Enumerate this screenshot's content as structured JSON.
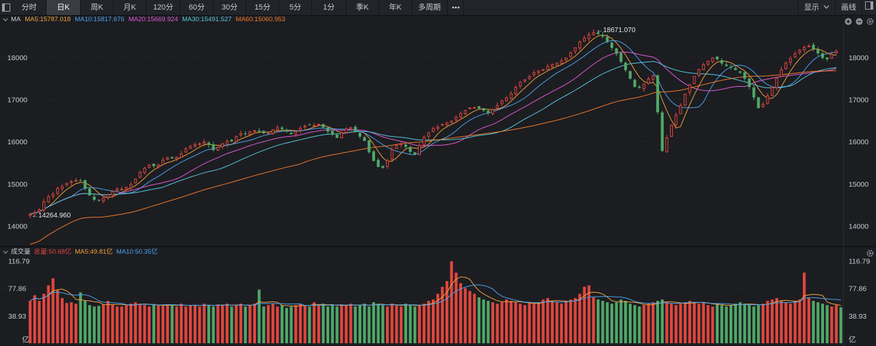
{
  "toolbar": {
    "tabs": [
      "分时",
      "日K",
      "周K",
      "月K",
      "120分",
      "60分",
      "30分",
      "15分",
      "5分",
      "1分",
      "季K",
      "年K",
      "多周期"
    ],
    "active_index": 1,
    "more_icon": "more-dots-icon",
    "display_label": "显示",
    "draw_label": "画线"
  },
  "price_panel": {
    "indicator": "MA",
    "ma_items": [
      {
        "label": "MA5:15787.018",
        "color": "#f0a33a"
      },
      {
        "label": "MA10:15817.676",
        "color": "#4aa3f0"
      },
      {
        "label": "MA20:15669.924",
        "color": "#e05ad6"
      },
      {
        "label": "MA30:15491.527",
        "color": "#56c8de"
      },
      {
        "label": "MA60:15060.953",
        "color": "#f07a2a"
      }
    ],
    "y_ticks": [
      "18000",
      "17000",
      "16000",
      "15000",
      "14000"
    ],
    "high_label": "18671.070",
    "low_label": "14264.960"
  },
  "volume_panel": {
    "title": "成交量",
    "total_label": "总量:50.68亿",
    "ma5_label": "MA5:49.81亿",
    "ma10_label": "MA10:50.35亿",
    "y_ticks": [
      "116.79",
      "77.86",
      "38.93"
    ],
    "unit": "亿"
  },
  "colors": {
    "up": "#e0463e",
    "down": "#4fa868",
    "ma5": "#f0a33a",
    "ma10": "#4aa3f0",
    "ma20": "#e05ad6",
    "ma30": "#56c8de",
    "ma60": "#f07a2a"
  },
  "chart_data": [
    {
      "type": "candlestick",
      "ylim": [
        13550,
        18750
      ],
      "annotations": {
        "high": 18671.07,
        "low": 14264.96
      },
      "series": [
        {
          "name": "MA5",
          "value_last": 15787.018
        },
        {
          "name": "MA10",
          "value_last": 15817.676
        },
        {
          "name": "MA20",
          "value_last": 15669.924
        },
        {
          "name": "MA30",
          "value_last": 15491.527
        },
        {
          "name": "MA60",
          "value_last": 15060.953
        }
      ],
      "close": [
        14280,
        14330,
        14390,
        14580,
        14700,
        14760,
        14900,
        14940,
        15020,
        15060,
        15090,
        15070,
        14880,
        14720,
        14620,
        14600,
        14660,
        14750,
        14830,
        14880,
        14880,
        14920,
        14990,
        15120,
        15280,
        15380,
        15450,
        15420,
        15450,
        15570,
        15620,
        15600,
        15640,
        15720,
        15840,
        15900,
        15940,
        15960,
        16000,
        15920,
        15800,
        15880,
        15960,
        16020,
        16010,
        16130,
        16200,
        16180,
        16240,
        16270,
        16240,
        16200,
        16210,
        16290,
        16340,
        16300,
        16240,
        16180,
        16250,
        16330,
        16380,
        16400,
        16390,
        16420,
        16340,
        16240,
        16170,
        16090,
        16220,
        16310,
        16340,
        16230,
        16120,
        16020,
        15750,
        15540,
        15400,
        15380,
        15560,
        15820,
        15920,
        15960,
        15880,
        15760,
        15700,
        15920,
        16110,
        16220,
        16320,
        16360,
        16420,
        16460,
        16500,
        16590,
        16680,
        16750,
        16810,
        16820,
        16790,
        16740,
        16680,
        16770,
        16870,
        16980,
        17050,
        17150,
        17300,
        17420,
        17480,
        17560,
        17650,
        17690,
        17720,
        17800,
        17840,
        17880,
        17930,
        18000,
        18120,
        18240,
        18380,
        18470,
        18550,
        18600,
        18560,
        18500,
        18370,
        18230,
        18090,
        17900,
        17700,
        17500,
        17300,
        17280,
        17380,
        17500,
        17580,
        16700,
        15780,
        16100,
        16400,
        16640,
        16870,
        17140,
        17360,
        17560,
        17720,
        17840,
        17920,
        18000,
        17960,
        17860,
        17800,
        17760,
        17700,
        17640,
        17500,
        17300,
        17050,
        16800,
        16900,
        17100,
        17300,
        17520,
        17720,
        17880,
        17980,
        18100,
        18180,
        18250,
        18280,
        18200,
        18100,
        17990,
        17960,
        18080,
        18160
      ],
      "volume": [
        60,
        68,
        60,
        70,
        82,
        92,
        75,
        64,
        57,
        58,
        56,
        72,
        60,
        54,
        52,
        53,
        55,
        60,
        55,
        52,
        52,
        54,
        56,
        58,
        56,
        54,
        52,
        55,
        54,
        53,
        55,
        54,
        52,
        56,
        52,
        54,
        54,
        52,
        56,
        54,
        52,
        55,
        54,
        56,
        52,
        54,
        56,
        52,
        54,
        56,
        76,
        52,
        54,
        56,
        52,
        54,
        50,
        52,
        54,
        56,
        54,
        52,
        58,
        54,
        56,
        52,
        54,
        52,
        55,
        54,
        56,
        52,
        54,
        56,
        52,
        58,
        56,
        54,
        52,
        56,
        54,
        52,
        56,
        54,
        52,
        54,
        56,
        60,
        62,
        70,
        80,
        88,
        116,
        100,
        85,
        78,
        74,
        70,
        65,
        62,
        60,
        58,
        56,
        58,
        62,
        60,
        58,
        56,
        54,
        58,
        56,
        58,
        62,
        64,
        60,
        58,
        56,
        60,
        62,
        64,
        70,
        80,
        82,
        65,
        62,
        60,
        58,
        56,
        58,
        62,
        60,
        56,
        54,
        52,
        54,
        56,
        58,
        60,
        62,
        58,
        56,
        54,
        56,
        58,
        60,
        58,
        56,
        58,
        54,
        52,
        56,
        54,
        52,
        54,
        56,
        58,
        56,
        54,
        52,
        54,
        56,
        60,
        62,
        64,
        60,
        58,
        56,
        60,
        62,
        100,
        64,
        60,
        58,
        56,
        54,
        52,
        54,
        51
      ]
    }
  ]
}
